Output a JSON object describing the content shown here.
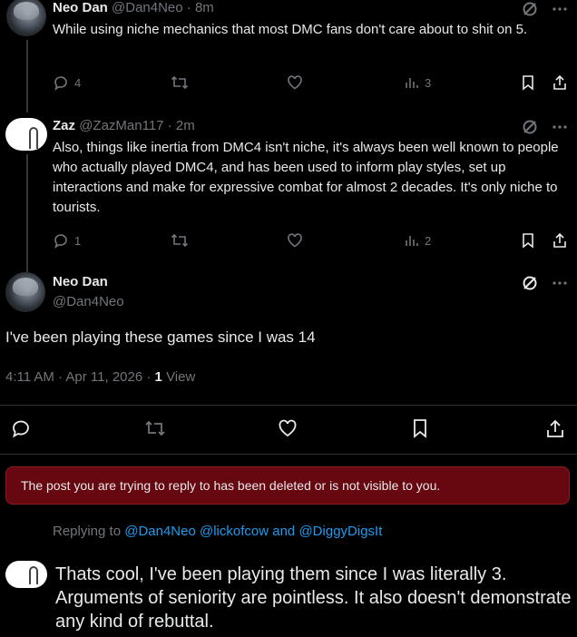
{
  "tweet1": {
    "name": "Neo Dan",
    "handle": "@Dan4Neo",
    "time": "· 8m",
    "text": "While using niche mechanics that most DMC fans don't care about to shit on 5.",
    "replies": "4",
    "views": "3"
  },
  "tweet2": {
    "name": "Zaz",
    "handle": "@ZazMan117",
    "time": "· 2m",
    "text": "Also, things like inertia from DMC4 isn't niche, it's always been well known to people who actually played DMC4, and has been used to inform play styles, set up interactions and make for expressive combat for almost 2 decades. It's only niche to tourists.",
    "replies": "1",
    "views": "2"
  },
  "main_tweet": {
    "name": "Neo Dan",
    "handle": "@Dan4Neo",
    "text": "I've been playing these games since I was 14",
    "timestamp": "4:11 AM · Apr 11, 2026 · ",
    "view_count": "1",
    "view_label": "View"
  },
  "banner": {
    "text": "The post you are trying to reply to has been deleted or is not visible to you."
  },
  "reply": {
    "replying_to_label": "Replying to ",
    "mention1": "@Dan4Neo",
    "mention2": "@lickofcow",
    "and_label": "and",
    "mention3": "@DiggyDigsIt",
    "draft_text": "Thats cool, I've been playing them since I was literally 3. Arguments of seniority are pointless. It also doesn't demonstrate any kind of rebuttal."
  },
  "colors": {
    "background": "#000000",
    "text": "#e7e9ea",
    "muted": "#71767b",
    "link": "#1d9bf0",
    "banner_bg": "#67070f"
  },
  "icons": [
    "reply-icon",
    "retweet-icon",
    "like-icon",
    "views-icon",
    "bookmark-icon",
    "share-icon",
    "grok-icon",
    "more-icon"
  ]
}
